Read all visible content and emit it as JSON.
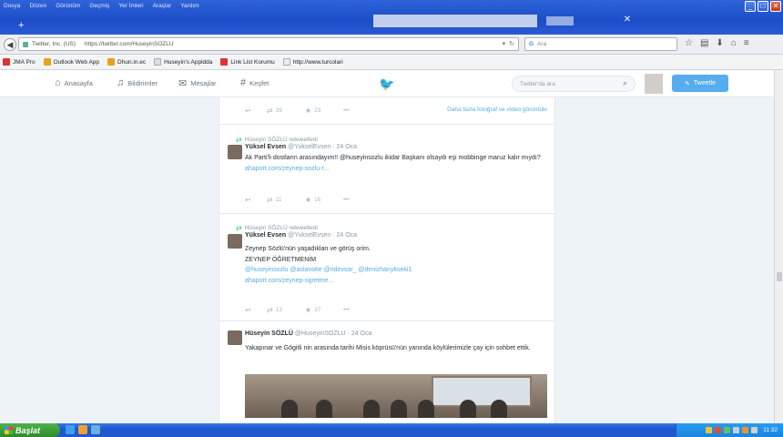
{
  "browser": {
    "menu": [
      "Dosya",
      "Düzen",
      "Görünüm",
      "Geçmiş",
      "Yer İmleri",
      "Araçlar",
      "Yardım"
    ],
    "url_host": "Twitter, Inc. (US)",
    "url": "https://twitter.com/HuseyinSOZLU",
    "search_placeholder": "Ara",
    "search_engine": "G"
  },
  "bookmarks": [
    {
      "label": "JMA Pro",
      "color": "#d33"
    },
    {
      "label": "Outlook Web App",
      "color": "#e6a21a"
    },
    {
      "label": "Dhun.in.ec",
      "color": "#e6a21a"
    },
    {
      "label": "Huseyin's Appldda",
      "color": "#ddd"
    },
    {
      "label": "Link List Korumu",
      "color": "#d33"
    },
    {
      "label": "http://www.turcolari",
      "color": "#eee"
    }
  ],
  "twitter": {
    "nav": [
      {
        "label": "Anasayfa",
        "icon": "home-icon",
        "glyph": "⌂"
      },
      {
        "label": "Bildirimler",
        "icon": "bell-icon",
        "glyph": "🔔"
      },
      {
        "label": "Mesajlar",
        "icon": "mail-icon",
        "glyph": "✉"
      },
      {
        "label": "Keşfet",
        "icon": "hashtag-icon",
        "glyph": "#"
      }
    ],
    "search_placeholder": "Twitter'da ara",
    "tweet_button": "Tweetle",
    "brand_color": "#55acee"
  },
  "tweets": [
    {
      "partial_actions": {
        "retweets": "39",
        "favorites": "23",
        "more": "•••"
      },
      "media_link": "Daha fazla fotoğraf ve video görüntüle"
    },
    {
      "retweeted_by": "Hüseyin SÖZLÜ retweetledi",
      "name": "Yüksel Evsen",
      "handle": "@YukselEvsen",
      "time": "· 24 Oca",
      "text": "Ak Parti'li dostların arasındayım!! @huseyinsozlu ikidar Başkanı olsaydı eşi mobbinge maruz kalır mıydı?",
      "mention": "@huseyinsozlu",
      "link": "ahaport.com/zeynep-sozlu-t...",
      "retweets": "11",
      "favorites": "16",
      "more": "•••"
    },
    {
      "retweeted_by": "Hüseyin SÖZLÜ retweetledi",
      "name": "Yüksel Evsen",
      "handle": "@YukselEvsen",
      "time": "· 24 Oca",
      "text_line1": "Zeynep Sözlü'nün yaşadıkları ve görüş orim.",
      "text_line2": "ZEYNEP ÖĞRETMENİM",
      "mentions": "@huseyinsozlu @aslanoke @ridevsar_ @denizhanykseki1",
      "link": "ahaport.com/zeynep-ogretme...",
      "retweets": "13",
      "favorites": "37",
      "more": "•••"
    },
    {
      "name": "Hüseyin SÖZLÜ",
      "handle": "@HuseyinSOZLU",
      "time": "· 24 Oca",
      "text": "Yakapınar ve Gögitli nin arasında tarihi Misis köprüsü'nün yanında köylülerimizle çay için sohbet ettik."
    }
  ],
  "taskbar": {
    "start_label": "Başlat",
    "clock": "11:32"
  }
}
